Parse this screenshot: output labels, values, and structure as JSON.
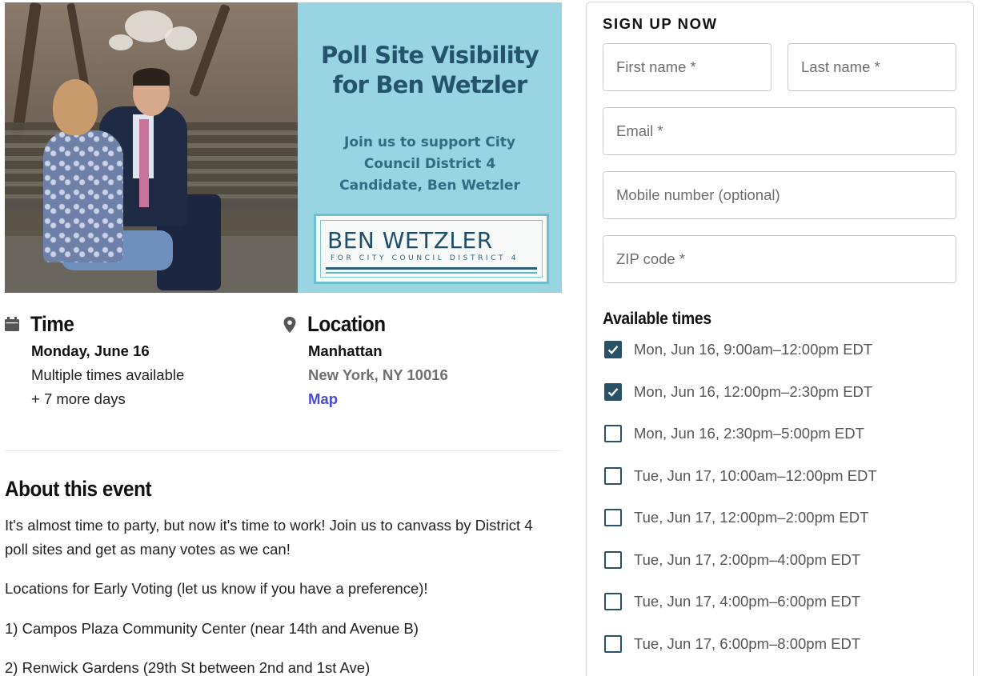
{
  "banner": {
    "title_line1": "Poll Site Visibility",
    "title_line2": "for Ben Wetzler",
    "subtitle_line1": "Join us to support City",
    "subtitle_line2": "Council District 4",
    "subtitle_line3": "Candidate, Ben Wetzler",
    "logo_name": "BEN WETZLER",
    "logo_tagline": "FOR CITY COUNCIL DISTRICT 4",
    "colors": {
      "panel_bg": "#99d4e2",
      "title_text": "#24546c"
    }
  },
  "time": {
    "heading": "Time",
    "date": "Monday, June 16",
    "detail": "Multiple times available",
    "more": "+ 7 more days",
    "icon": "calendar-icon"
  },
  "location": {
    "heading": "Location",
    "place": "Manhattan",
    "address": "New York, NY 10016",
    "map_link": "Map",
    "icon": "map-pin-icon"
  },
  "about": {
    "heading": "About this event",
    "paragraphs": [
      "It's almost time to party, but now it's time to work! Join us to canvass by District 4 poll sites and get as many votes as we can!",
      "Locations for Early Voting (let us know if you have a preference)!",
      "1) Campos Plaza Community Center (near 14th and Avenue B)",
      "2) Renwick Gardens (29th St between 2nd and 1st Ave)"
    ]
  },
  "signup": {
    "title": "SIGN UP NOW",
    "first_name_placeholder": "First name *",
    "last_name_placeholder": "Last name *",
    "email_placeholder": "Email *",
    "mobile_placeholder": "Mobile number (optional)",
    "zip_placeholder": "ZIP code *",
    "times_heading": "Available times",
    "times": [
      {
        "label": "Mon, Jun 16, 9:00am–12:00pm EDT",
        "checked": true
      },
      {
        "label": "Mon, Jun 16, 12:00pm–2:30pm EDT",
        "checked": true
      },
      {
        "label": "Mon, Jun 16, 2:30pm–5:00pm EDT",
        "checked": false
      },
      {
        "label": "Tue, Jun 17, 10:00am–12:00pm EDT",
        "checked": false
      },
      {
        "label": "Tue, Jun 17, 12:00pm–2:00pm EDT",
        "checked": false
      },
      {
        "label": "Tue, Jun 17, 2:00pm–4:00pm EDT",
        "checked": false
      },
      {
        "label": "Tue, Jun 17, 4:00pm–6:00pm EDT",
        "checked": false
      },
      {
        "label": "Tue, Jun 17, 6:00pm–8:00pm EDT",
        "checked": false
      }
    ],
    "colors": {
      "checkbox": "#2a5266"
    }
  }
}
